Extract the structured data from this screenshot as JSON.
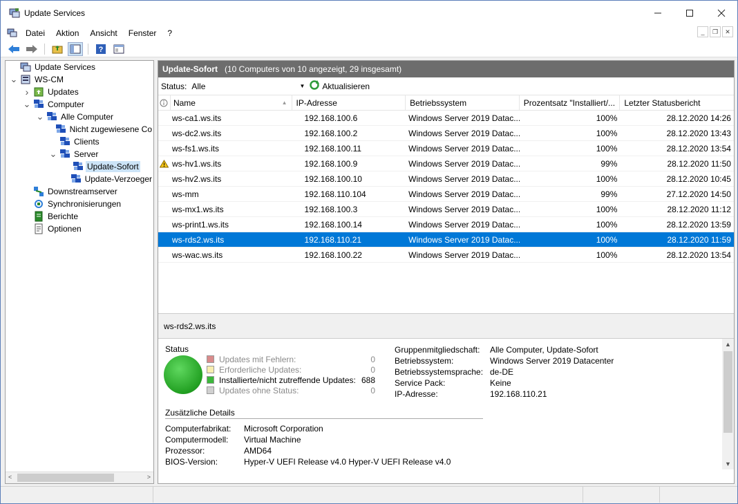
{
  "window": {
    "title": "Update Services"
  },
  "menu": [
    "Datei",
    "Aktion",
    "Ansicht",
    "Fenster",
    "?"
  ],
  "tree": [
    {
      "label": "Update Services",
      "level": 0,
      "exp": "",
      "icon": "wsus-icon"
    },
    {
      "label": "WS-CM",
      "level": 0,
      "exp": "v",
      "icon": "server-icon"
    },
    {
      "label": "Updates",
      "level": 1,
      "exp": ">",
      "icon": "updates-icon"
    },
    {
      "label": "Computer",
      "level": 1,
      "exp": "v",
      "icon": "computers-icon"
    },
    {
      "label": "Alle Computer",
      "level": 2,
      "exp": "v",
      "icon": "computers-icon"
    },
    {
      "label": "Nicht zugewiesene Co",
      "level": 3,
      "exp": "",
      "icon": "computers-icon"
    },
    {
      "label": "Clients",
      "level": 3,
      "exp": "",
      "icon": "computers-icon"
    },
    {
      "label": "Server",
      "level": 3,
      "exp": "v",
      "icon": "computers-icon"
    },
    {
      "label": "Update-Sofort",
      "level": 4,
      "exp": "",
      "icon": "computers-icon",
      "selected": true
    },
    {
      "label": "Update-Verzoeger",
      "level": 4,
      "exp": "",
      "icon": "computers-icon"
    },
    {
      "label": "Downstreamserver",
      "level": 1,
      "exp": "",
      "icon": "downstream-icon"
    },
    {
      "label": "Synchronisierungen",
      "level": 1,
      "exp": "",
      "icon": "sync-icon"
    },
    {
      "label": "Berichte",
      "level": 1,
      "exp": "",
      "icon": "reports-icon"
    },
    {
      "label": "Optionen",
      "level": 1,
      "exp": "",
      "icon": "options-icon"
    }
  ],
  "header": {
    "title": "Update-Sofort",
    "subtitle": "(10 Computers von 10 angezeigt, 29 insgesamt)"
  },
  "filter": {
    "status_label": "Status:",
    "status_value": "Alle",
    "refresh_label": "Aktualisieren"
  },
  "columns": [
    "Name",
    "IP-Adresse",
    "Betriebssystem",
    "Prozentsatz \"Installiert/...",
    "Letzter Statusbericht"
  ],
  "rows": [
    {
      "name": "ws-ca1.ws.its",
      "ip": "192.168.100.6",
      "os": "Windows Server 2019 Datac...",
      "pct": "100%",
      "last": "28.12.2020 14:26"
    },
    {
      "name": "ws-dc2.ws.its",
      "ip": "192.168.100.2",
      "os": "Windows Server 2019 Datac...",
      "pct": "100%",
      "last": "28.12.2020 13:43"
    },
    {
      "name": "ws-fs1.ws.its",
      "ip": "192.168.100.11",
      "os": "Windows Server 2019 Datac...",
      "pct": "100%",
      "last": "28.12.2020 13:54"
    },
    {
      "name": "ws-hv1.ws.its",
      "ip": "192.168.100.9",
      "os": "Windows Server 2019 Datac...",
      "pct": "99%",
      "last": "28.12.2020 11:50",
      "warning": true
    },
    {
      "name": "ws-hv2.ws.its",
      "ip": "192.168.100.10",
      "os": "Windows Server 2019 Datac...",
      "pct": "100%",
      "last": "28.12.2020 10:45"
    },
    {
      "name": "ws-mm",
      "ip": "192.168.110.104",
      "os": "Windows Server 2019 Datac...",
      "pct": "99%",
      "last": "27.12.2020 14:50"
    },
    {
      "name": "ws-mx1.ws.its",
      "ip": "192.168.100.3",
      "os": "Windows Server 2019 Datac...",
      "pct": "100%",
      "last": "28.12.2020 11:12"
    },
    {
      "name": "ws-print1.ws.its",
      "ip": "192.168.100.14",
      "os": "Windows Server 2019 Datac...",
      "pct": "100%",
      "last": "28.12.2020 13:59"
    },
    {
      "name": "ws-rds2.ws.its",
      "ip": "192.168.110.21",
      "os": "Windows Server 2019 Datac...",
      "pct": "100%",
      "last": "28.12.2020 11:59",
      "selected": true
    },
    {
      "name": "ws-wac.ws.its",
      "ip": "192.168.100.22",
      "os": "Windows Server 2019 Datac...",
      "pct": "100%",
      "last": "28.12.2020 13:54"
    }
  ],
  "selected_computer": "ws-rds2.ws.its",
  "status_panel": {
    "title": "Status",
    "items": [
      {
        "label": "Updates mit Fehlern:",
        "value": "0",
        "color": "#d98b8b",
        "dim": true
      },
      {
        "label": "Erforderliche Updates:",
        "value": "0",
        "color": "#f7eeb0",
        "dim": true
      },
      {
        "label": "Installierte/nicht zutreffende Updates:",
        "value": "688",
        "color": "#3cb83c",
        "dim": false
      },
      {
        "label": "Updates ohne Status:",
        "value": "0",
        "color": "#d0d0d0",
        "dim": true
      }
    ]
  },
  "info": [
    {
      "k": "Gruppenmitgliedschaft:",
      "v": "Alle Computer, Update-Sofort"
    },
    {
      "k": "Betriebssystem:",
      "v": "Windows Server 2019 Datacenter"
    },
    {
      "k": "Betriebssystemsprache:",
      "v": "de-DE"
    },
    {
      "k": "Service Pack:",
      "v": "Keine"
    },
    {
      "k": "IP-Adresse:",
      "v": "192.168.110.21"
    }
  ],
  "details": {
    "title": "Zusätzliche Details",
    "items": [
      {
        "k": "Computerfabrikat:",
        "v": "Microsoft Corporation"
      },
      {
        "k": "Computermodell:",
        "v": "Virtual Machine"
      },
      {
        "k": "Prozessor:",
        "v": "AMD64"
      },
      {
        "k": "BIOS-Version:",
        "v": "Hyper-V UEFI Release v4.0 Hyper-V UEFI Release v4.0"
      }
    ]
  },
  "colors": {
    "selection": "#0078d7",
    "header_bar": "#6d6d6d",
    "status_ok": "#3cb83c"
  }
}
